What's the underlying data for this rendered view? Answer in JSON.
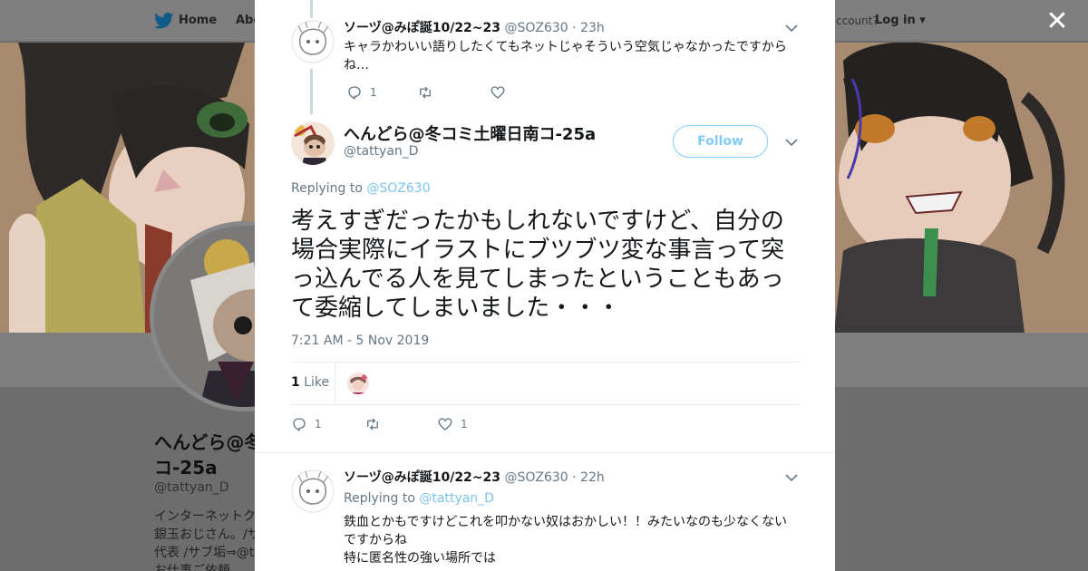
{
  "topbar": {
    "home_label": "Home",
    "about_label": "Abo",
    "account_question": "ccount?",
    "login_label": "Log in"
  },
  "profile": {
    "name": "へんどら@冬コミ土曜日南コ-25a",
    "name_visible": "へんどら@冬 コ-25a",
    "handle": "@tattyan_D",
    "bio_lines": [
      "インターネットク",
      "銀玉おじさん。/サ",
      "代表 /サブ垢⇒@t",
      "お仕事ご依頼"
    ]
  },
  "modal": {
    "close_icon": "close-icon",
    "tweets": [
      {
        "name": "ソーヅ@みぽ誕10/22~23",
        "handle": "@SOZ630",
        "dot": "·",
        "time": "23h",
        "text": "キャラかわいい語りしたくてもネットじゃそういう空気じゃなかったですからね…",
        "reply_count": "1",
        "retweet_count": "",
        "like_count": ""
      },
      {
        "name": "へんどら@冬コミ土曜日南コ-25a",
        "handle": "@tattyan_D",
        "follow_label": "Follow",
        "replying_prefix": "Replying to",
        "replying_handle": "@SOZ630",
        "text": "考えすぎだったかもしれないですけど、自分の場合実際にイラストにブツブツ変な事言って突っ込んでる人を見てしまったということもあって委縮してしまいました・・・",
        "timestamp": "7:21 AM - 5 Nov 2019",
        "likes_number": "1",
        "likes_word": "Like",
        "reply_count": "1",
        "retweet_count": "",
        "like_count": "1"
      },
      {
        "name": "ソーヅ@みぽ誕10/22~23",
        "handle": "@SOZ630",
        "dot": "·",
        "time": "22h",
        "replying_prefix": "Replying to",
        "replying_handle": "@tattyan_D",
        "text_lines": [
          "鉄血とかもですけどこれを叩かない奴はおかしい！！みたいなのも少なくない",
          "ですからね",
          "特に匿名性の強い場所では"
        ]
      }
    ]
  },
  "colors": {
    "accent": "#1da1f2",
    "link": "#7ec3ee",
    "muted": "#657786",
    "text": "#14171a",
    "overlay_bg": "#6d6d6d"
  }
}
